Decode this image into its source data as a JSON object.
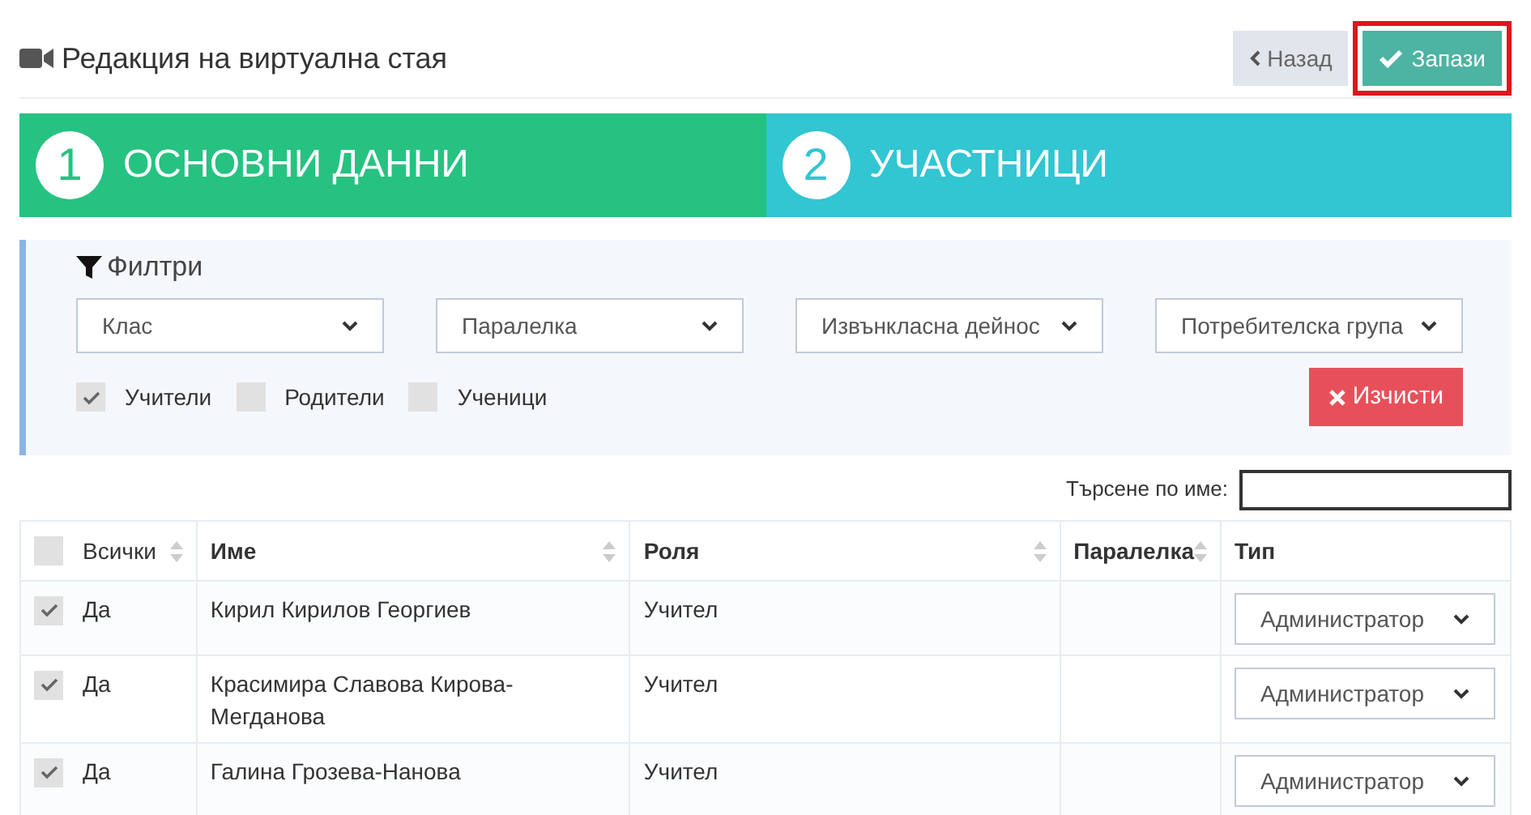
{
  "header": {
    "title": "Редакция на виртуална стая",
    "back_button": "Назад",
    "save_button": "Запази",
    "save_highlighted": true
  },
  "steps": [
    {
      "number": "1",
      "label": "ОСНОВНИ ДАННИ",
      "color": "#26c281"
    },
    {
      "number": "2",
      "label": "УЧАСТНИЦИ",
      "color": "#32c5d2"
    }
  ],
  "filters": {
    "title": "Филтри",
    "selects": [
      "Клас",
      "Паралелка",
      "Извънкласна дейнос",
      "Потребителска група"
    ],
    "checkboxes": [
      {
        "label": "Учители",
        "checked": true
      },
      {
        "label": "Родители",
        "checked": false
      },
      {
        "label": "Ученици",
        "checked": false
      }
    ],
    "clear_button": "Изчисти"
  },
  "search": {
    "label": "Търсене по име:"
  },
  "table": {
    "select_all_checked": false,
    "columns": [
      {
        "label": "Всички",
        "sortable": true
      },
      {
        "label": "Име",
        "sortable": true
      },
      {
        "label": "Роля",
        "sortable": true
      },
      {
        "label": "Паралелка",
        "sortable": true
      },
      {
        "label": "Тип",
        "sortable": false
      }
    ],
    "rows": [
      {
        "checked": true,
        "selected_text": "Да",
        "name": "Кирил Кирилов Георгиев",
        "role": "Учител",
        "type": "Администратор"
      },
      {
        "checked": true,
        "selected_text": "Да",
        "name": "Красимира Славова Кирова-Мегданова",
        "role": "Учител",
        "type": "Администратор"
      },
      {
        "checked": true,
        "selected_text": "Да",
        "name": "Галина Грозева-Нанова",
        "role": "Учител",
        "type": "Администратор"
      }
    ]
  }
}
